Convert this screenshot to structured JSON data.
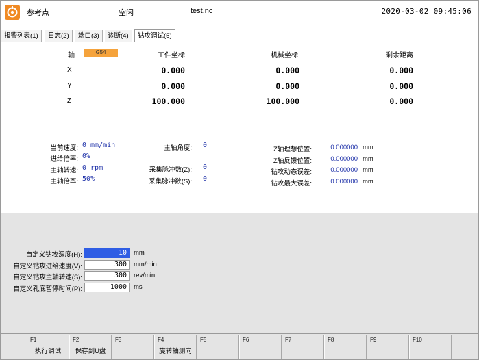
{
  "title": {
    "mode": "参考点",
    "state": "空闲",
    "file": "test.nc",
    "datetime": "2020-03-02 09:45:06"
  },
  "tabs": [
    {
      "label": "报警列表(1)",
      "active": false
    },
    {
      "label": "日志(2)",
      "active": false
    },
    {
      "label": "端口(3)",
      "active": false
    },
    {
      "label": "诊断(4)",
      "active": false
    },
    {
      "label": "钻攻调试(5)",
      "active": true
    }
  ],
  "coords": {
    "axis_label": "轴",
    "wcs": "G54",
    "headers": {
      "work": "工件坐标",
      "machine": "机械坐标",
      "remain": "剩余距离"
    },
    "rows": [
      {
        "axis": "X",
        "work": "0.000",
        "machine": "0.000",
        "remain": "0.000"
      },
      {
        "axis": "Y",
        "work": "0.000",
        "machine": "0.000",
        "remain": "0.000"
      },
      {
        "axis": "Z",
        "work": "100.000",
        "machine": "100.000",
        "remain": "0.000"
      }
    ]
  },
  "status": {
    "left": [
      {
        "label": "当前速度:",
        "value": "0 mm/min"
      },
      {
        "label": "进给倍率:",
        "value": "0%"
      },
      {
        "label": "主轴转速:",
        "value": "0 rpm"
      },
      {
        "label": "主轴倍率:",
        "value": "50%"
      }
    ],
    "middle": [
      {
        "label": "主轴角度:",
        "value": "0"
      },
      {
        "label": "采集脉冲数(Z):",
        "value": "0"
      },
      {
        "label": "采集脉冲数(S):",
        "value": "0"
      }
    ],
    "right": [
      {
        "label": "Z轴理想位置:",
        "value": "0.000000",
        "unit": "mm"
      },
      {
        "label": "Z轴反馈位置:",
        "value": "0.000000",
        "unit": "mm"
      },
      {
        "label": "钻攻动态误差:",
        "value": "0.000000",
        "unit": "mm"
      },
      {
        "label": "钻攻最大误差:",
        "value": "0.000000",
        "unit": "mm"
      }
    ]
  },
  "params": [
    {
      "label": "自定义钻攻深度(H):",
      "value": "10",
      "unit": "mm",
      "selected": true
    },
    {
      "label": "自定义钻攻进给速度(V):",
      "value": "300",
      "unit": "mm/min",
      "selected": false
    },
    {
      "label": "自定义钻攻主轴转速(S):",
      "value": "300",
      "unit": "rev/min",
      "selected": false
    },
    {
      "label": "自定义孔底暂停时间(P):",
      "value": "1000",
      "unit": "ms",
      "selected": false
    }
  ],
  "fkeys": [
    {
      "key": "F1",
      "label": "执行调试"
    },
    {
      "key": "F2",
      "label": "保存到U盘"
    },
    {
      "key": "F3",
      "label": ""
    },
    {
      "key": "F4",
      "label": "旋转轴测向"
    },
    {
      "key": "F5",
      "label": ""
    },
    {
      "key": "F6",
      "label": ""
    },
    {
      "key": "F7",
      "label": ""
    },
    {
      "key": "F8",
      "label": ""
    },
    {
      "key": "F9",
      "label": ""
    },
    {
      "key": "F10",
      "label": ""
    }
  ]
}
